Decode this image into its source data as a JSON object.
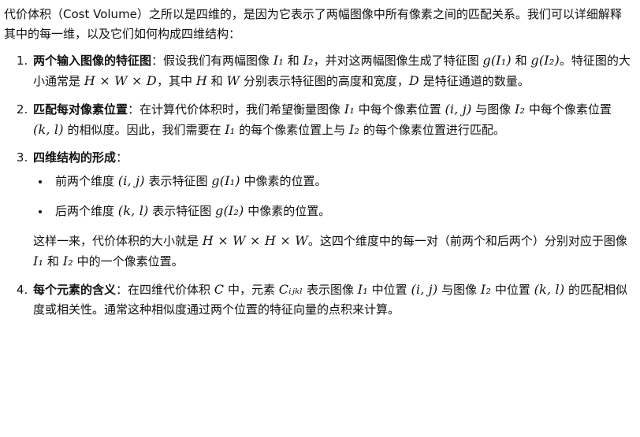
{
  "intro": "代价体积（Cost Volume）之所以是四维的，是因为它表示了两幅图像中所有像素之间的匹配关系。我们可以详细解释其中的每一维，以及它们如何构成四维结构：",
  "items": [
    {
      "number": "1.",
      "label": "两个输入图像的特征图",
      "parts": [
        {
          "t": "text",
          "v": "：假设我们有两幅图像 "
        },
        {
          "t": "math",
          "v": "I₁"
        },
        {
          "t": "text",
          "v": " 和 "
        },
        {
          "t": "math",
          "v": "I₂"
        },
        {
          "t": "text",
          "v": "，并对这两幅图像生成了特征图 "
        },
        {
          "t": "math",
          "v": "g(I₁)"
        },
        {
          "t": "text",
          "v": " 和 "
        },
        {
          "t": "math",
          "v": "g(I₂)"
        },
        {
          "t": "text",
          "v": "。特征图的大小通常是 "
        },
        {
          "t": "math",
          "v": "H × W × D"
        },
        {
          "t": "text",
          "v": "，其中 "
        },
        {
          "t": "math",
          "v": "H"
        },
        {
          "t": "text",
          "v": " 和 "
        },
        {
          "t": "math",
          "v": "W"
        },
        {
          "t": "text",
          "v": " 分别表示特征图的高度和宽度，"
        },
        {
          "t": "math",
          "v": "D"
        },
        {
          "t": "text",
          "v": " 是特征通道的数量。"
        }
      ]
    },
    {
      "number": "2.",
      "label": "匹配每对像素位置",
      "parts": [
        {
          "t": "text",
          "v": "：在计算代价体积时，我们希望衡量图像 "
        },
        {
          "t": "math",
          "v": "I₁"
        },
        {
          "t": "text",
          "v": " 中每个像素位置 "
        },
        {
          "t": "math",
          "v": "(i, j)"
        },
        {
          "t": "text",
          "v": " 与图像 "
        },
        {
          "t": "math",
          "v": "I₂"
        },
        {
          "t": "text",
          "v": " 中每个像素位置 "
        },
        {
          "t": "math",
          "v": "(k, l)"
        },
        {
          "t": "text",
          "v": " 的相似度。因此，我们需要在 "
        },
        {
          "t": "math",
          "v": "I₁"
        },
        {
          "t": "text",
          "v": " 的每个像素位置上与 "
        },
        {
          "t": "math",
          "v": "I₂"
        },
        {
          "t": "text",
          "v": " 的每个像素位置进行匹配。"
        }
      ]
    },
    {
      "number": "3.",
      "label": "四维结构的形成",
      "parts": [
        {
          "t": "text",
          "v": "："
        }
      ],
      "bullets": [
        [
          {
            "t": "text",
            "v": "前两个维度 "
          },
          {
            "t": "math",
            "v": "(i, j)"
          },
          {
            "t": "text",
            "v": " 表示特征图 "
          },
          {
            "t": "math",
            "v": "g(I₁)"
          },
          {
            "t": "text",
            "v": " 中像素的位置。"
          }
        ],
        [
          {
            "t": "text",
            "v": "后两个维度 "
          },
          {
            "t": "math",
            "v": "(k, l)"
          },
          {
            "t": "text",
            "v": " 表示特征图 "
          },
          {
            "t": "math",
            "v": "g(I₂)"
          },
          {
            "t": "text",
            "v": " 中像素的位置。"
          }
        ]
      ],
      "after": [
        {
          "t": "text",
          "v": "这样一来，代价体积的大小就是 "
        },
        {
          "t": "math",
          "v": "H × W × H × W"
        },
        {
          "t": "text",
          "v": "。这四个维度中的每一对（前两个和后两个）分别对应于图像 "
        },
        {
          "t": "math",
          "v": "I₁"
        },
        {
          "t": "text",
          "v": " 和 "
        },
        {
          "t": "math",
          "v": "I₂"
        },
        {
          "t": "text",
          "v": " 中的一个像素位置。"
        }
      ]
    },
    {
      "number": "4.",
      "label": "每个元素的含义",
      "parts": [
        {
          "t": "text",
          "v": "：在四维代价体积 "
        },
        {
          "t": "math",
          "v": "C"
        },
        {
          "t": "text",
          "v": " 中，元素 "
        },
        {
          "t": "math",
          "v": "Cᵢⱼₖₗ"
        },
        {
          "t": "text",
          "v": " 表示图像 "
        },
        {
          "t": "math",
          "v": "I₁"
        },
        {
          "t": "text",
          "v": " 中位置 "
        },
        {
          "t": "math",
          "v": "(i, j)"
        },
        {
          "t": "text",
          "v": " 与图像 "
        },
        {
          "t": "math",
          "v": "I₂"
        },
        {
          "t": "text",
          "v": " 中位置 "
        },
        {
          "t": "math",
          "v": "(k, l)"
        },
        {
          "t": "text",
          "v": " 的匹配相似度或相关性。通常这种相似度通过两个位置的特征向量的点积来计算。"
        }
      ]
    }
  ]
}
